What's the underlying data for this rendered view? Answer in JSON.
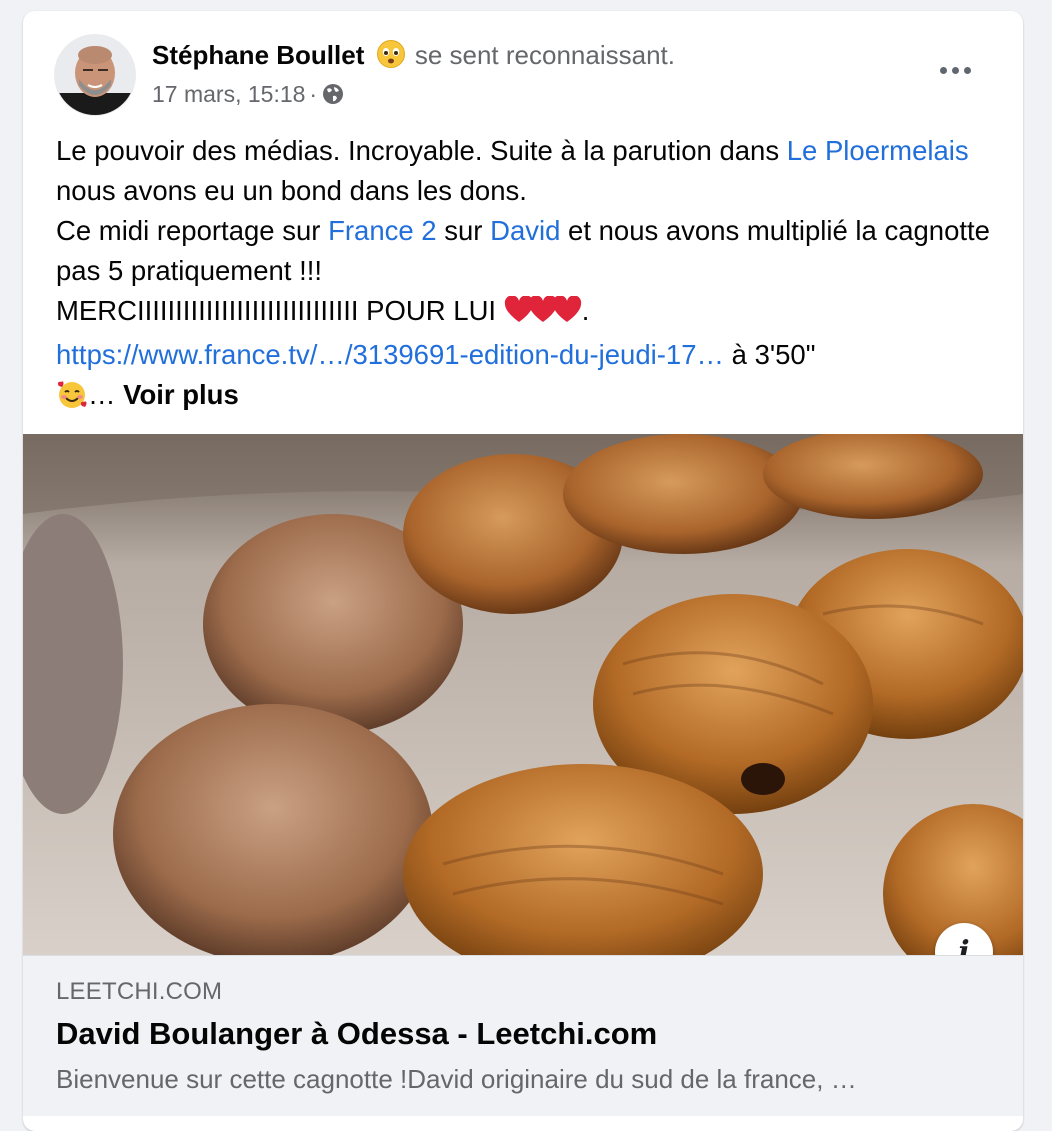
{
  "post": {
    "author": "Stéphane Boullet",
    "feeling": "se sent reconnaissant.",
    "feeling_icon": "grateful-face-emoji",
    "timestamp": "17 mars, 15:18",
    "separator": "·",
    "privacy_icon": "globe-icon",
    "more_icon": "more-options-icon",
    "body": {
      "line1_a": "Le pouvoir des médias. Incroyable. Suite à la parution dans ",
      "link_le_ploermelais": "Le Ploermelais",
      "line1_b": " nous avons eu un bond dans les dons.",
      "line2_a": "Ce midi reportage sur ",
      "link_france2": "France 2",
      "line2_b": " sur ",
      "link_david": "David",
      "line2_c": " et nous avons multiplié la cagnotte pas 5 pratiquement !!!",
      "line3": "MERCIIIIIIIIIIIIIIIIIIIIIIIIIIIII POUR LUI ",
      "line3_end": ".",
      "url": "https://www.france.tv/…/3139691-edition-du-jeudi-17…",
      "url_suffix": " à 3'50\"",
      "ellipsis": "… ",
      "see_more": "Voir plus"
    },
    "link_preview": {
      "domain": "LEETCHI.COM",
      "title": "David Boulanger à Odessa - Leetchi.com",
      "description": "Bienvenue sur cette cagnotte !David originaire du sud de la france, …",
      "info_icon": "i"
    }
  },
  "colors": {
    "link": "#216fdb",
    "secondary_text": "#65676b",
    "heart": "#e0243a"
  }
}
